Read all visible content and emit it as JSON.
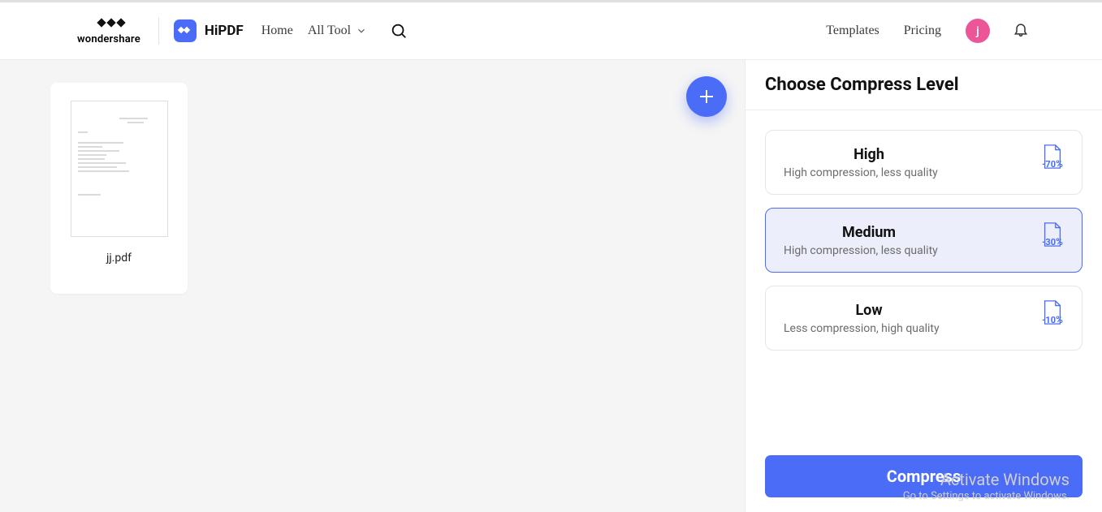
{
  "brand": {
    "wondershare": "wondershare",
    "hipdf": "HiPDF"
  },
  "nav": {
    "home": "Home",
    "all_tool": "All Tool"
  },
  "header_right": {
    "templates": "Templates",
    "pricing": "Pricing",
    "avatar_letter": "j"
  },
  "workspace": {
    "file_name": "jj.pdf"
  },
  "panel": {
    "title": "Choose Compress Level",
    "options": [
      {
        "title": "High",
        "subtitle": "High compression, less quality",
        "reduce": "-70",
        "pct_suffix": "%",
        "selected": false
      },
      {
        "title": "Medium",
        "subtitle": "High compression, less quality",
        "reduce": "-30",
        "pct_suffix": "%",
        "selected": true
      },
      {
        "title": "Low",
        "subtitle": "Less compression, high quality",
        "reduce": "-10",
        "pct_suffix": "%",
        "selected": false
      }
    ],
    "button": "Compress"
  },
  "watermark": {
    "line1": "Activate Windows",
    "line2": "Go to Settings to activate Windows."
  }
}
